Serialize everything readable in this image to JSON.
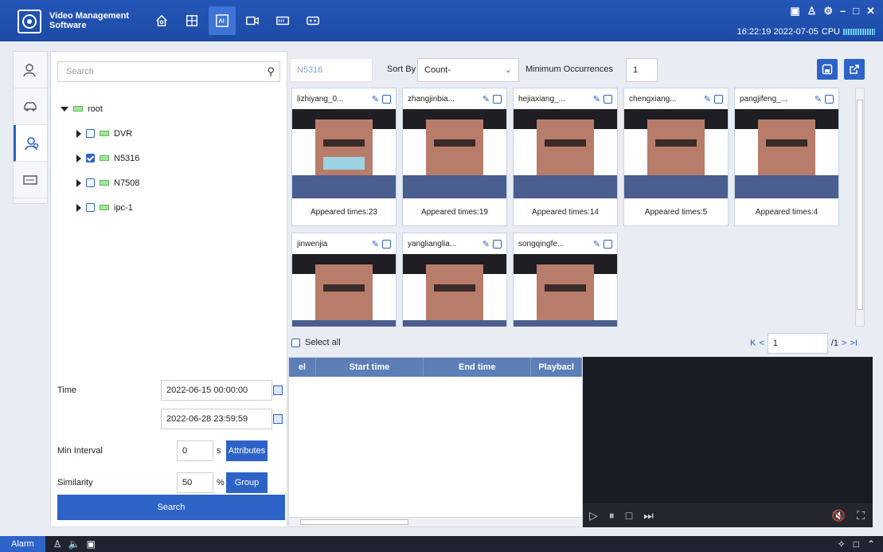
{
  "app": {
    "title_line1": "Video Management",
    "title_line2": "Software"
  },
  "topnav": [
    {
      "icon": "home-icon",
      "active": false
    },
    {
      "icon": "grid-view-icon",
      "active": false
    },
    {
      "icon": "ai-search-icon",
      "active": true
    },
    {
      "icon": "camera-icon",
      "active": false
    },
    {
      "icon": "nvr-icon",
      "active": false
    },
    {
      "icon": "device-icon",
      "active": false
    }
  ],
  "window_controls": [
    "▣",
    "♙",
    "⚙",
    "–",
    "□",
    "✕"
  ],
  "status": {
    "time": "16:22:19 2022-07-05",
    "cpu_label": "CPU"
  },
  "sidebar_icons": [
    "face-search-icon",
    "vehicle-icon",
    "person-group-icon",
    "plate-icon"
  ],
  "left": {
    "search_placeholder": "Search",
    "tree": {
      "root": "root",
      "children": [
        {
          "label": "DVR",
          "checked": false
        },
        {
          "label": "N5316",
          "checked": true
        },
        {
          "label": "N7508",
          "checked": false
        },
        {
          "label": "ipc-1",
          "checked": false
        }
      ]
    },
    "time_label": "Time",
    "start_time": "2022-06-15 00:00:00",
    "end_time": "2022-06-28 23:59:59",
    "min_interval_label": "Min Interval",
    "min_interval_value": "0",
    "min_interval_unit": "s",
    "attributes_button": "Attributes",
    "similarity_label": "Similarity",
    "similarity_value": "50",
    "similarity_unit": "%",
    "group_button": "Group",
    "search_button": "Search"
  },
  "toolbar": {
    "device": "N5316",
    "sort_label": "Sort By",
    "sort_value": "Count-",
    "min_occ_label": "Minimum Occurrences",
    "min_occ_value": "1"
  },
  "cards": [
    {
      "name": "lizhiyang_0...",
      "appeared": "Appeared times:23",
      "mask": true
    },
    {
      "name": "zhangjinbia...",
      "appeared": "Appeared times:19",
      "mask": false
    },
    {
      "name": "hejiaxiang_...",
      "appeared": "Appeared times:14",
      "mask": false
    },
    {
      "name": "chengxiang...",
      "appeared": "Appeared times:5",
      "mask": false
    },
    {
      "name": "pangjifeng_...",
      "appeared": "Appeared times:4",
      "mask": false
    },
    {
      "name": "jinwenjia",
      "appeared": "",
      "mask": false
    },
    {
      "name": "yanglianglia...",
      "appeared": "",
      "mask": false
    },
    {
      "name": "songqingfe...",
      "appeared": "",
      "mask": false
    }
  ],
  "select_all": "Select all",
  "pager": {
    "first": "K",
    "prev": "<",
    "page": "1",
    "total": "/1",
    "next": ">",
    "last": ">I"
  },
  "table": {
    "headers": [
      "el",
      "Start time",
      "End time",
      "Playbacl"
    ]
  },
  "video_controls": {
    "play": "▷",
    "pause": "⏸",
    "stop": "□",
    "next": "⏭",
    "mute": "🔇",
    "fullscreen": "⛶"
  },
  "bottom": {
    "alarm": "Alarm"
  }
}
